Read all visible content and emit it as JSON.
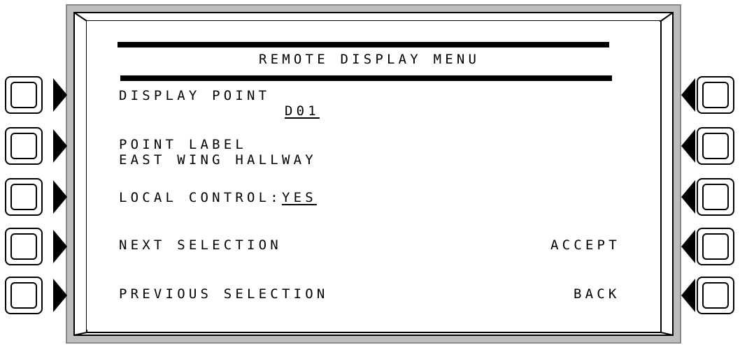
{
  "screen": {
    "title": "REMOTE DISPLAY MENU",
    "display_point_label": "DISPLAY POINT",
    "display_point_value": "D01",
    "point_label_heading": "POINT LABEL",
    "point_label_value": "EAST WING HALLWAY",
    "local_control_label": "LOCAL CONTROL:",
    "local_control_value": "YES",
    "next_selection": "NEXT SELECTION",
    "previous_selection": "PREVIOUS SELECTION",
    "accept": "ACCEPT",
    "back": "BACK"
  },
  "colors": {
    "bezel": "#bdbdbd",
    "screen": "#ffffff",
    "text": "#000000"
  }
}
